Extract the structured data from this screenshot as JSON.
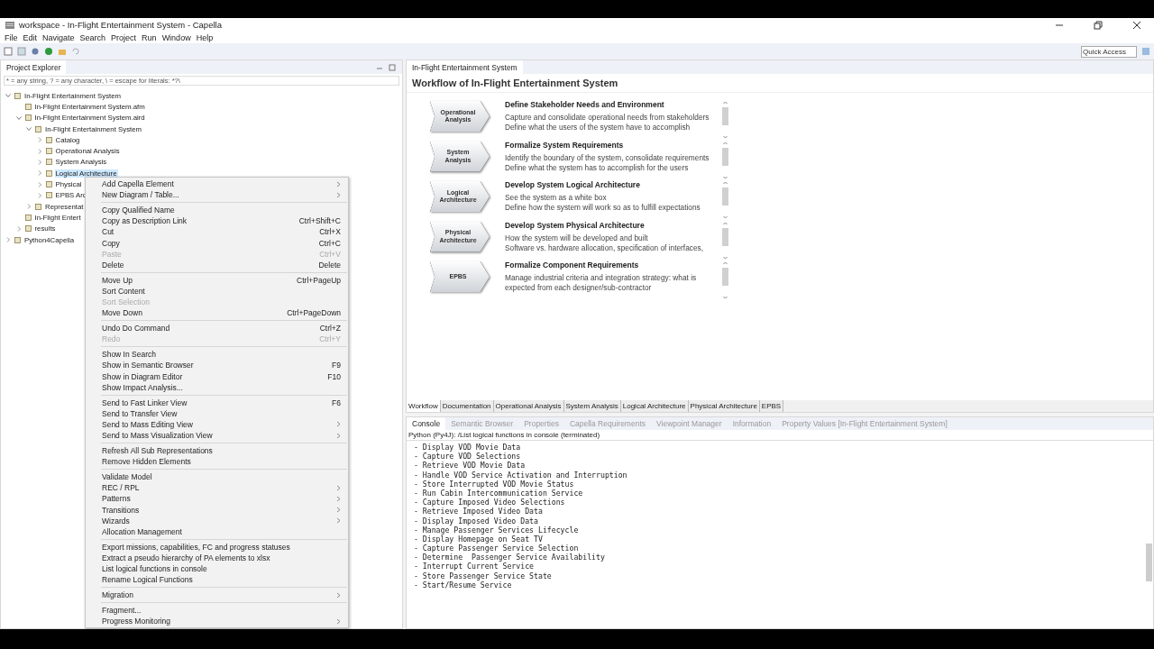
{
  "window": {
    "title": "workspace - In-Flight Entertainment System - Capella"
  },
  "menu_bar": [
    "File",
    "Edit",
    "Navigate",
    "Search",
    "Project",
    "Run",
    "Window",
    "Help"
  ],
  "quick_access": {
    "placeholder": "Quick Access"
  },
  "project_explorer": {
    "title": "Project Explorer",
    "filter_hint": "* = any string, ? = any character, \\ = escape for literals: *?\\",
    "tree": [
      {
        "label": "In-Flight Entertainment System",
        "expanded": true,
        "selected": false,
        "children": [
          {
            "label": "In-Flight Entertainment System.afm",
            "selected": false
          },
          {
            "label": "In-Flight Entertainment System.aird",
            "expanded": true,
            "selected": false,
            "children": [
              {
                "label": "In-Flight Entertainment System",
                "expanded": true,
                "selected": false,
                "children": [
                  {
                    "label": "Catalog",
                    "expanded": false,
                    "selected": false
                  },
                  {
                    "label": "Operational Analysis",
                    "expanded": false,
                    "selected": false
                  },
                  {
                    "label": "System Analysis",
                    "expanded": false,
                    "selected": false
                  },
                  {
                    "label": "Logical Architecture",
                    "expanded": false,
                    "selected": true
                  },
                  {
                    "label": "Physical",
                    "expanded": false,
                    "selected": false
                  },
                  {
                    "label": "EPBS Arc",
                    "expanded": false,
                    "selected": false
                  }
                ]
              },
              {
                "label": "Representat",
                "expanded": false,
                "selected": false
              }
            ]
          },
          {
            "label": "In-Flight Entert",
            "selected": false
          },
          {
            "label": "results",
            "expanded": false,
            "selected": false
          }
        ]
      },
      {
        "label": "Python4Capella",
        "expanded": false,
        "selected": false
      }
    ]
  },
  "context_menu": [
    [
      {
        "label": "Add Capella Element",
        "submenu": true,
        "disabled": false
      },
      {
        "label": "New Diagram / Table...",
        "submenu": true,
        "disabled": false
      }
    ],
    [
      {
        "label": "Copy Qualified Name",
        "disabled": false
      },
      {
        "label": "Copy as Description Link",
        "shortcut": "Ctrl+Shift+C",
        "disabled": false
      },
      {
        "label": "Cut",
        "shortcut": "Ctrl+X",
        "disabled": false
      },
      {
        "label": "Copy",
        "shortcut": "Ctrl+C",
        "disabled": false
      },
      {
        "label": "Paste",
        "shortcut": "Ctrl+V",
        "disabled": true
      },
      {
        "label": "Delete",
        "shortcut": "Delete",
        "disabled": false
      }
    ],
    [
      {
        "label": "Move Up",
        "shortcut": "Ctrl+PageUp",
        "disabled": false
      },
      {
        "label": "Sort Content",
        "disabled": false
      },
      {
        "label": "Sort Selection",
        "disabled": true
      },
      {
        "label": "Move Down",
        "shortcut": "Ctrl+PageDown",
        "disabled": false
      }
    ],
    [
      {
        "label": "Undo Do Command",
        "shortcut": "Ctrl+Z",
        "disabled": false
      },
      {
        "label": "Redo",
        "shortcut": "Ctrl+Y",
        "disabled": true
      }
    ],
    [
      {
        "label": "Show In Search",
        "disabled": false
      },
      {
        "label": "Show in Semantic Browser",
        "shortcut": "F9",
        "disabled": false
      },
      {
        "label": "Show in Diagram Editor",
        "shortcut": "F10",
        "disabled": false
      },
      {
        "label": "Show Impact Analysis...",
        "disabled": false
      }
    ],
    [
      {
        "label": "Send to Fast Linker View",
        "shortcut": "F6",
        "disabled": false
      },
      {
        "label": "Send to Transfer View",
        "disabled": false
      },
      {
        "label": "Send to Mass Editing View",
        "submenu": true,
        "disabled": false
      },
      {
        "label": "Send to Mass Visualization View",
        "submenu": true,
        "disabled": false
      }
    ],
    [
      {
        "label": "Refresh All Sub Representations",
        "disabled": false
      },
      {
        "label": "Remove Hidden Elements",
        "disabled": false
      }
    ],
    [
      {
        "label": "Validate Model",
        "disabled": false
      },
      {
        "label": "REC / RPL",
        "submenu": true,
        "disabled": false
      },
      {
        "label": "Patterns",
        "submenu": true,
        "disabled": false
      },
      {
        "label": "Transitions",
        "submenu": true,
        "disabled": false
      },
      {
        "label": "Wizards",
        "submenu": true,
        "disabled": false
      },
      {
        "label": "Allocation Management",
        "disabled": false
      }
    ],
    [
      {
        "label": "Export missions, capabilities, FC and progress statuses",
        "disabled": false
      },
      {
        "label": "Extract a pseudo hierarchy of PA elements to xlsx",
        "disabled": false
      },
      {
        "label": "List logical functions in console",
        "disabled": false
      },
      {
        "label": "Rename Logical Functions",
        "disabled": false
      }
    ],
    [
      {
        "label": "Migration",
        "submenu": true,
        "disabled": false
      }
    ],
    [
      {
        "label": "Fragment...",
        "disabled": false
      },
      {
        "label": "Progress Monitoring",
        "submenu": true,
        "disabled": false
      }
    ]
  ],
  "editor": {
    "tab": "In-Flight Entertainment System",
    "heading": "Workflow of In-Flight Entertainment System",
    "steps": [
      {
        "chevron": "Operational Analysis",
        "title": "Define Stakeholder Needs and Environment",
        "lines": [
          "Capture and consolidate operational needs from stakeholders",
          "Define what the users of the system have to accomplish"
        ]
      },
      {
        "chevron": "System Analysis",
        "title": "Formalize System Requirements",
        "lines": [
          "Identify the boundary of the system, consolidate requirements",
          "Define what the system has to accomplish for the users"
        ]
      },
      {
        "chevron": "Logical Architecture",
        "title": "Develop System Logical Architecture",
        "lines": [
          "See the system as a white box",
          "Define how the system will work so as to fulfill expectations"
        ]
      },
      {
        "chevron": "Physical Architecture",
        "title": "Develop System Physical Architecture",
        "lines": [
          "How the system will be developed and built",
          "Software vs. hardware allocation, specification of interfaces,"
        ]
      },
      {
        "chevron": "EPBS",
        "title": "Formalize Component Requirements",
        "lines": [
          "Manage industrial criteria and integration strategy: what is",
          "expected from each designer/sub-contractor"
        ]
      }
    ],
    "pages": [
      {
        "label": "Workflow",
        "selected": true
      },
      {
        "label": "Documentation",
        "selected": false
      },
      {
        "label": "Operational Analysis",
        "selected": false
      },
      {
        "label": "System Analysis",
        "selected": false
      },
      {
        "label": "Logical Architecture",
        "selected": false
      },
      {
        "label": "Physical Architecture",
        "selected": false
      },
      {
        "label": "EPBS",
        "selected": false
      }
    ]
  },
  "bottom_views": [
    {
      "label": "Console",
      "selected": true
    },
    {
      "label": "Semantic Browser",
      "selected": false
    },
    {
      "label": "Properties",
      "selected": false
    },
    {
      "label": "Capella Requirements",
      "selected": false
    },
    {
      "label": "Viewpoint Manager",
      "selected": false
    },
    {
      "label": "Information",
      "selected": false
    },
    {
      "label": "Property Values [In-Flight Entertainment System]",
      "selected": false
    }
  ],
  "console": {
    "header": "Python (Py4J): /List logical functions in console (terminated)",
    "lines": [
      " - Display VOD Movie Data",
      " - Capture VOD Selections",
      " - Retrieve VOD Movie Data",
      " - Handle VOD Service Activation and Interruption",
      " - Store Interrupted VOD Movie Status",
      " - Run Cabin Intercommunication Service",
      " - Capture Imposed Video Selections",
      " - Retrieve Imposed Video Data",
      " - Display Imposed Video Data",
      " - Manage Passenger Services Lifecycle",
      " - Display Homepage on Seat TV",
      " - Capture Passenger Service Selection",
      " - Determine  Passenger Service Availability",
      " - Interrupt Current Service",
      " - Store Passenger Service State",
      " - Start/Resume Service"
    ]
  }
}
